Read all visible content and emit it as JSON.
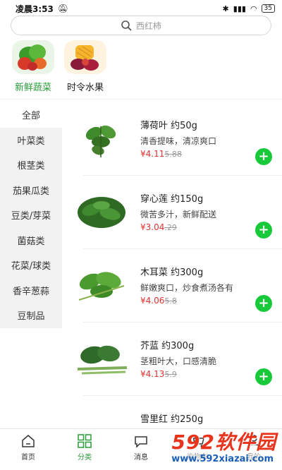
{
  "status_bar": {
    "time": "凌晨3:53",
    "battery": "35"
  },
  "search": {
    "placeholder": "西红柿"
  },
  "top_categories": [
    {
      "label": "新鲜蔬菜",
      "icon": "vegetables-basket-icon",
      "active": true
    },
    {
      "label": "时令水果",
      "icon": "fruit-plate-icon",
      "active": false
    }
  ],
  "sidebar": {
    "items": [
      "全部",
      "叶菜类",
      "根茎类",
      "茄果瓜类",
      "豆类/芽菜",
      "菌菇类",
      "花菜/球类",
      "香辛葱蒜",
      "豆制品"
    ],
    "active_index": 0
  },
  "products": [
    {
      "name": "薄荷叶 约50g",
      "desc": "清香提味，清凉爽口",
      "price": "¥4.11",
      "orig_price": "5.88",
      "icon": "mint-leaves-icon"
    },
    {
      "name": "穿心莲 约150g",
      "desc": "微苦多汁，新鲜配送",
      "price": "¥3.04",
      "orig_price": ".29",
      "icon": "andrographis-icon"
    },
    {
      "name": "木耳菜 约300g",
      "desc": "鲜嫩爽口，炒食煮汤各有",
      "price": "¥4.06",
      "orig_price": "5.8",
      "icon": "malabar-spinach-icon"
    },
    {
      "name": "芥蓝 约300g",
      "desc": "茎粗叶大，口感清脆",
      "price": "¥4.13",
      "orig_price": "5.9",
      "icon": "chinese-kale-icon"
    },
    {
      "name": "雪里红 约250g",
      "desc": "",
      "price": "",
      "orig_price": "",
      "icon": "potherb-mustard-icon"
    }
  ],
  "tabbar": {
    "items": [
      {
        "label": "首页",
        "icon": "home-icon",
        "active": false
      },
      {
        "label": "分类",
        "icon": "grid-icon",
        "active": true
      },
      {
        "label": "消息",
        "icon": "message-icon",
        "active": false
      },
      {
        "label": "购物车",
        "icon": "cart-icon",
        "active": false
      },
      {
        "label": "我的",
        "icon": "user-icon",
        "active": false
      }
    ]
  },
  "watermark": {
    "brand": "592软件园",
    "url": "www.592xiazai.com"
  },
  "colors": {
    "accent_green": "#2a9d3a",
    "add_button": "#18c93a",
    "price_red": "#e03030",
    "sidebar_bg": "#f2f2f2"
  }
}
